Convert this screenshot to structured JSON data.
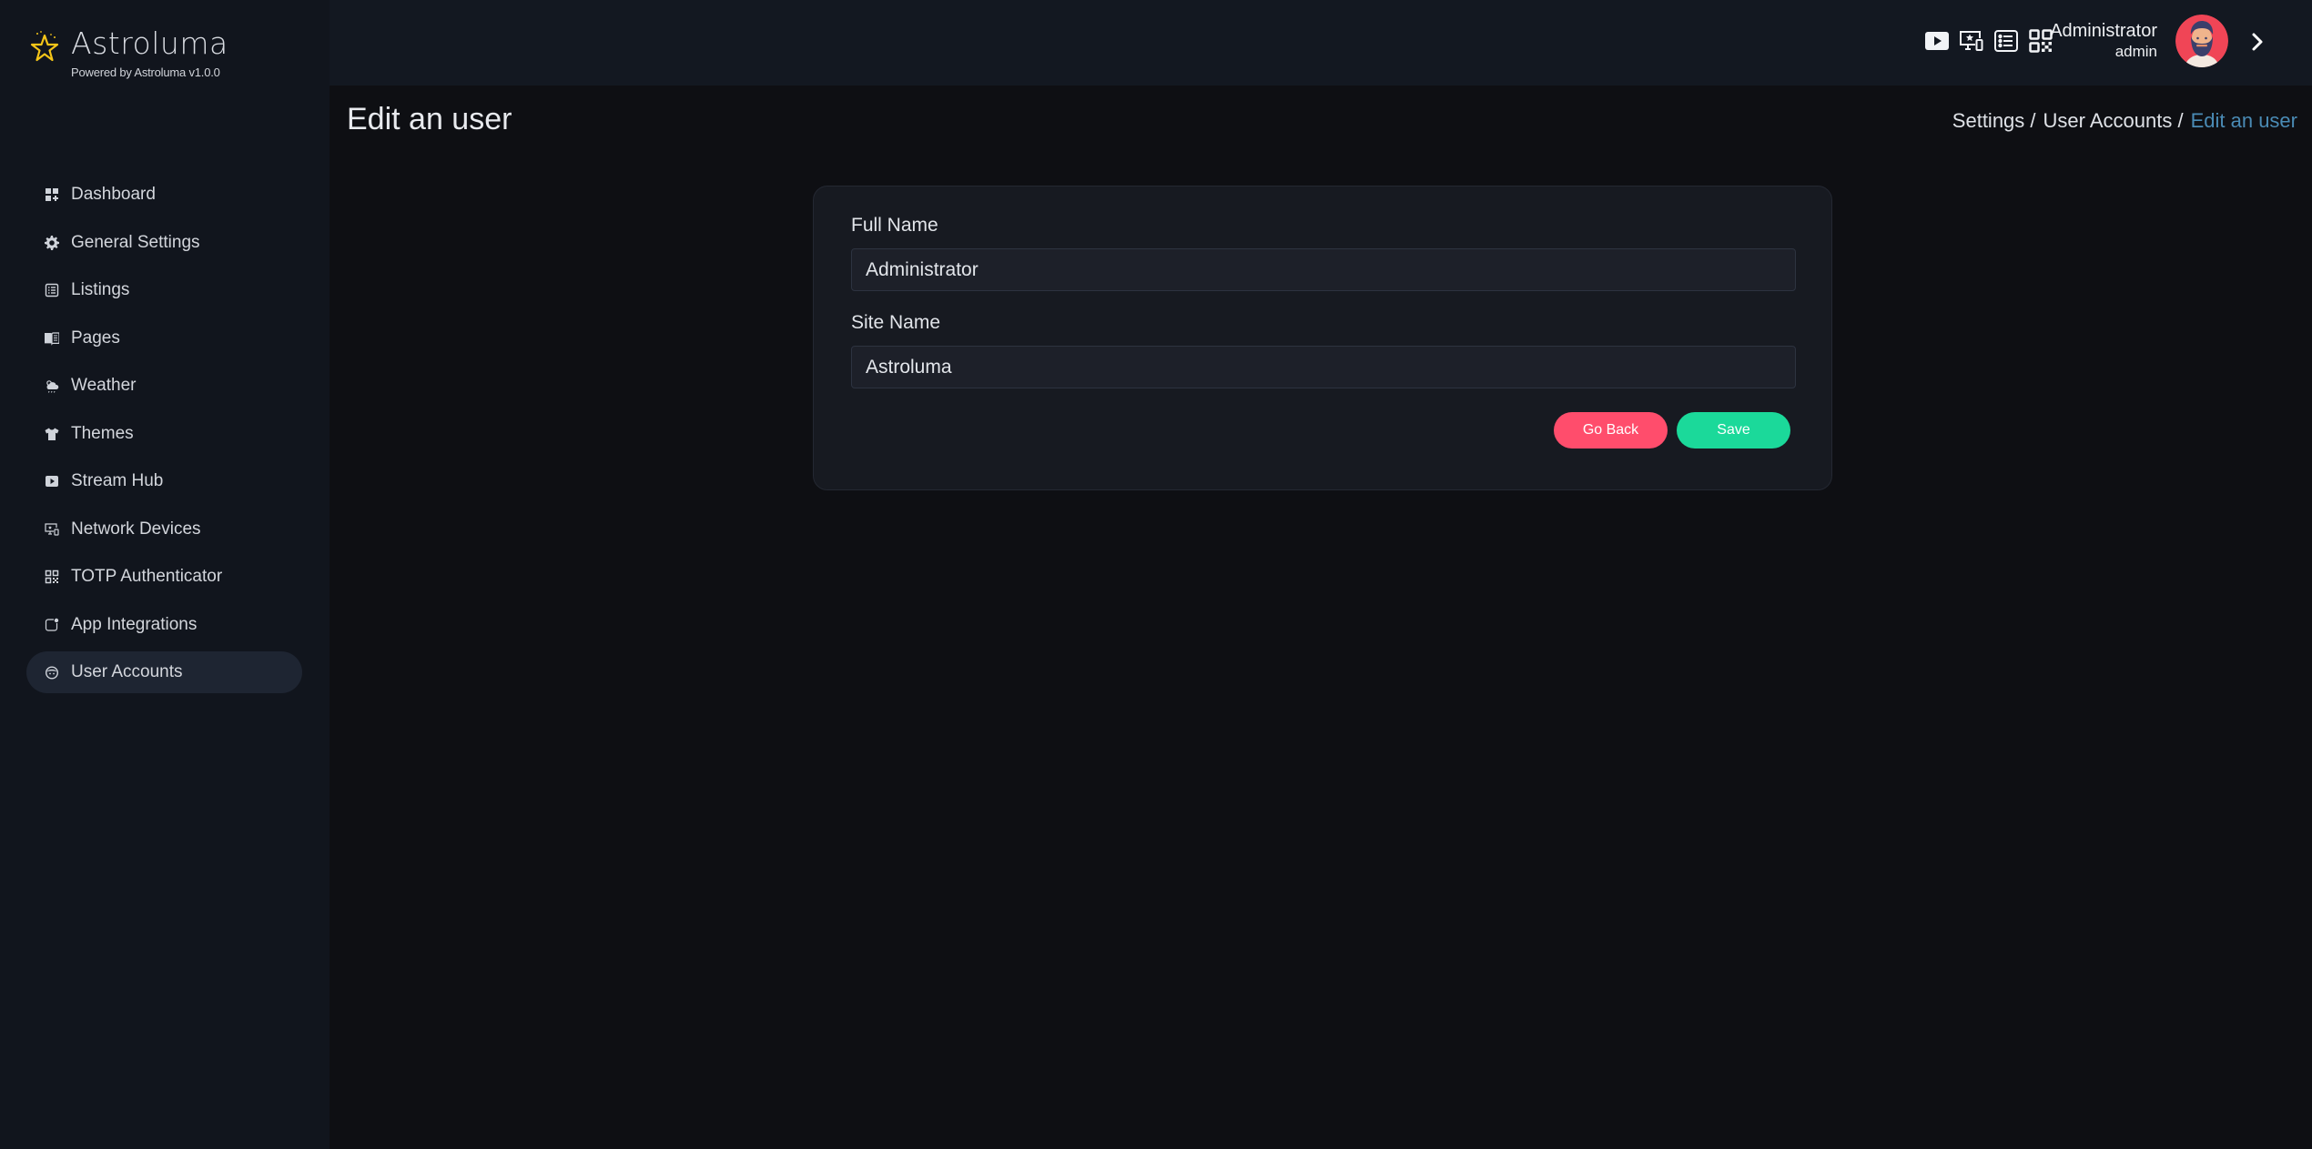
{
  "brand": {
    "title": "Astroluma",
    "subtitle": "Powered by Astroluma v1.0.0",
    "accent_color": "#f5c518"
  },
  "sidebar": {
    "items": [
      {
        "label": "Dashboard",
        "icon": "dashboard-icon",
        "active": false
      },
      {
        "label": "General Settings",
        "icon": "gear-icon",
        "active": false
      },
      {
        "label": "Listings",
        "icon": "list-icon",
        "active": false
      },
      {
        "label": "Pages",
        "icon": "book-icon",
        "active": false
      },
      {
        "label": "Weather",
        "icon": "weather-icon",
        "active": false
      },
      {
        "label": "Themes",
        "icon": "shirt-icon",
        "active": false
      },
      {
        "label": "Stream Hub",
        "icon": "play-icon",
        "active": false
      },
      {
        "label": "Network Devices",
        "icon": "devices-icon",
        "active": false
      },
      {
        "label": "TOTP Authenticator",
        "icon": "qr-code-icon",
        "active": false
      },
      {
        "label": "App Integrations",
        "icon": "app-badge-icon",
        "active": false
      },
      {
        "label": "User Accounts",
        "icon": "user-face-icon",
        "active": true
      }
    ]
  },
  "topbar": {
    "icons": [
      "play-icon",
      "devices-icon",
      "list-icon",
      "qr-code-icon"
    ],
    "user": {
      "name": "Administrator",
      "role": "admin"
    }
  },
  "page": {
    "title": "Edit an user",
    "breadcrumb": [
      {
        "label": "Settings /",
        "current": false
      },
      {
        "label": "User Accounts /",
        "current": false
      },
      {
        "label": "Edit an user",
        "current": true
      }
    ]
  },
  "form": {
    "full_name": {
      "label": "Full Name",
      "value": "Administrator"
    },
    "site_name": {
      "label": "Site Name",
      "value": "Astroluma"
    },
    "go_back_label": "Go Back",
    "save_label": "Save",
    "go_back_color": "#ff4d6c",
    "save_color": "#1bd99a"
  }
}
